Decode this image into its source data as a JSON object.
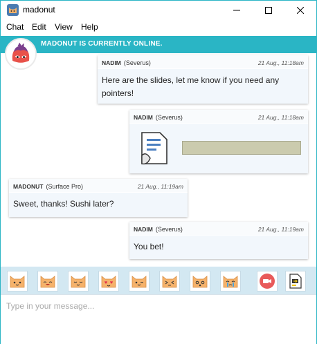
{
  "window": {
    "title": "madonut"
  },
  "menu": [
    "Chat",
    "Edit",
    "View",
    "Help"
  ],
  "status": {
    "text": "MADONUT IS CURRENTLY ONLINE."
  },
  "messages": [
    {
      "sender": "NADIM",
      "device": "(Severus)",
      "time": "21 Aug., 11:18am",
      "text_lines": [
        "Here are the slides, let me know if you need any",
        "pointers!"
      ]
    },
    {
      "sender": "NADIM",
      "device": "(Severus)",
      "time": "21 Aug., 11:18am",
      "attachment": "document-file-icon"
    },
    {
      "sender": "MADONUT",
      "device": "(Surface Pro)",
      "time": "21 Aug., 11:19am",
      "text_lines": [
        "Sweet, thanks! Sushi later?"
      ]
    },
    {
      "sender": "NADIM",
      "device": "(Severus)",
      "time": "21 Aug., 11:19am",
      "text_lines": [
        "You bet!"
      ]
    }
  ],
  "emoji_bar": {
    "emojis": [
      "cat-smile-icon",
      "cat-grin-icon",
      "cat-happy-icon",
      "cat-love-icon",
      "cat-wink-icon",
      "cat-squint-icon",
      "cat-surprised-icon",
      "cat-crying-icon"
    ],
    "actions": [
      "video-call-icon",
      "send-file-icon"
    ]
  },
  "input": {
    "placeholder": "Type in your message..."
  },
  "colors": {
    "accent": "#2ab5c5",
    "bubble": "#f2f7fc",
    "emoji_bar": "#d3e8f2",
    "cat": "#f5b26b"
  }
}
